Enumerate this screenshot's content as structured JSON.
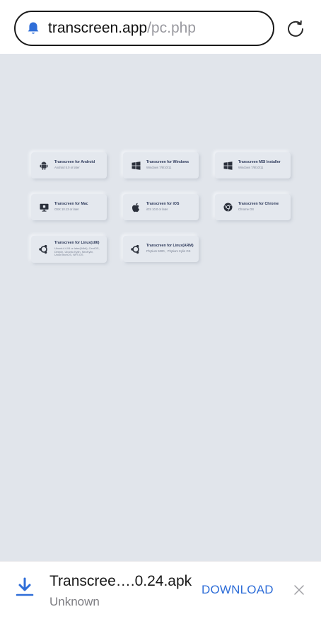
{
  "browser": {
    "url_domain": "transcreen.app",
    "url_path": "/pc.php"
  },
  "cards": [
    {
      "title": "Transcreen for Android",
      "subtitle": "Android 5.0 or later",
      "icon": "android-icon"
    },
    {
      "title": "Transcreen for Windows",
      "subtitle": "Windows 7/8/10/11",
      "icon": "windows-icon"
    },
    {
      "title": "Transcreen MSI Installer",
      "subtitle": "Windows 7/8/10/11",
      "icon": "windows-icon"
    },
    {
      "title": "Transcreen for Mac",
      "subtitle": "OSX 10.13 or later",
      "icon": "mac-icon"
    },
    {
      "title": "Transcreen for iOS",
      "subtitle": "iOS 10.0 or later",
      "icon": "apple-icon"
    },
    {
      "title": "Transcreen for Chrome",
      "subtitle": "Chrome OS",
      "icon": "chrome-icon"
    },
    {
      "title": "Transcreen for Linux(x86)",
      "subtitle": "Ubuntu14.04 or later(64bit), CentOS, Deepin, Ubuntu Kylin, NeoKylin, UnionTechOS, NFS OS",
      "icon": "ubuntu-icon"
    },
    {
      "title": "Transcreen for Linux(ARM)",
      "subtitle": "Phytium 5000、Phytium Kylin OS",
      "icon": "ubuntu-icon"
    }
  ],
  "download": {
    "filename": "Transcree….0.24.apk",
    "status": "Unknown",
    "action_label": "DOWNLOAD"
  },
  "colors": {
    "page_background": "#e1e5eb",
    "accent": "#2f6ed8",
    "card_title": "#2f3b5c"
  }
}
